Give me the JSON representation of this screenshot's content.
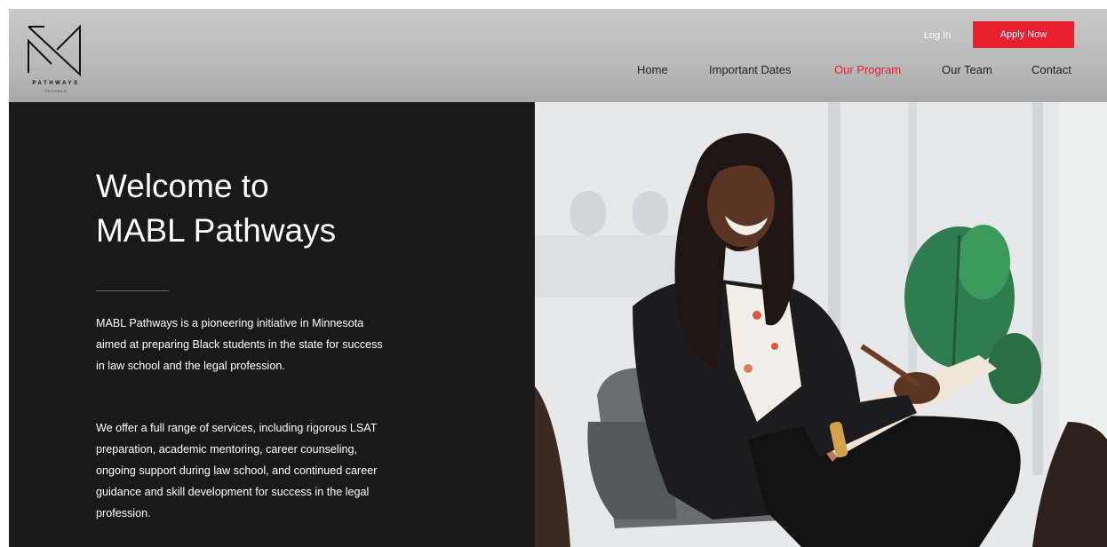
{
  "brand": {
    "logo_word": "PATHWAYS",
    "logo_sub": "PROGRAM"
  },
  "header": {
    "login_label": "Log In",
    "apply_label": "Apply Now"
  },
  "nav": {
    "items": [
      {
        "label": "Home"
      },
      {
        "label": "Important Dates"
      },
      {
        "label": "Our Program"
      },
      {
        "label": "Our Team"
      },
      {
        "label": "Contact"
      }
    ],
    "active": "Our Program"
  },
  "hero": {
    "title_line1": "Welcome to",
    "title_line2": "MABL Pathways",
    "paragraph1": "MABL Pathways is a pioneering initiative in Minnesota aimed at preparing Black students in the state for success in law school and the legal profession.",
    "paragraph2": "We offer a full range of services, including rigorous LSAT preparation, academic mentoring, career counseling, ongoing support during law school, and continued career guidance and skill development for success in the legal profession."
  },
  "colors": {
    "accent": "#e8202f",
    "panel": "#191919",
    "header": "#bcbcbc"
  }
}
